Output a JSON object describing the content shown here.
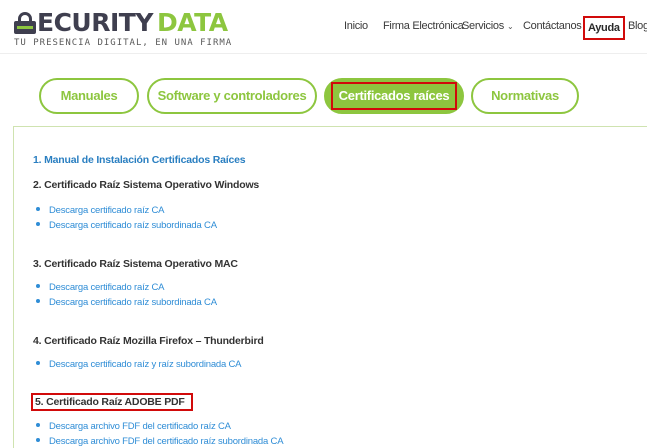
{
  "header": {
    "logo": {
      "word1": "ECURITY",
      "word2": "DATA",
      "tagline": "TU PRESENCIA DIGITAL, EN UNA FIRMA"
    },
    "nav": [
      {
        "label": "Inicio"
      },
      {
        "label": "Firma Electrónica"
      },
      {
        "label": "Servicios"
      },
      {
        "label": "Contáctanos"
      },
      {
        "label": "Ayuda"
      },
      {
        "label": "Blog"
      }
    ]
  },
  "tabs": [
    {
      "label": "Manuales"
    },
    {
      "label": "Software y controladores"
    },
    {
      "label": "Certificados raíces"
    },
    {
      "label": "Normativas"
    }
  ],
  "colors": {
    "brand_green": "#8dc63f",
    "brand_dark": "#3f3f4f",
    "link_blue": "#2f8dd6",
    "highlight_red": "#d10a0a"
  },
  "content": {
    "manual_link": "1. Manual de Instalación Certificados Raíces",
    "sections": [
      {
        "title": "2. Certificado Raíz Sistema Operativo Windows",
        "links": [
          "Descarga certificado raíz CA",
          "Descarga certificado raíz subordinada CA"
        ]
      },
      {
        "title": "3. Certificado Raíz Sistema Operativo MAC",
        "links": [
          "Descarga certificado raíz CA",
          "Descarga certificado raíz subordinada CA"
        ]
      },
      {
        "title": "4. Certificado Raíz Mozilla Firefox – Thunderbird",
        "links": [
          "Descarga certificado raíz y raíz subordinada CA"
        ]
      },
      {
        "title": "5. Certificado Raíz ADOBE PDF",
        "links": [
          "Descarga archivo FDF del certificado raíz CA",
          "Descarga archivo FDF del certificado raíz subordinada CA"
        ]
      }
    ]
  }
}
